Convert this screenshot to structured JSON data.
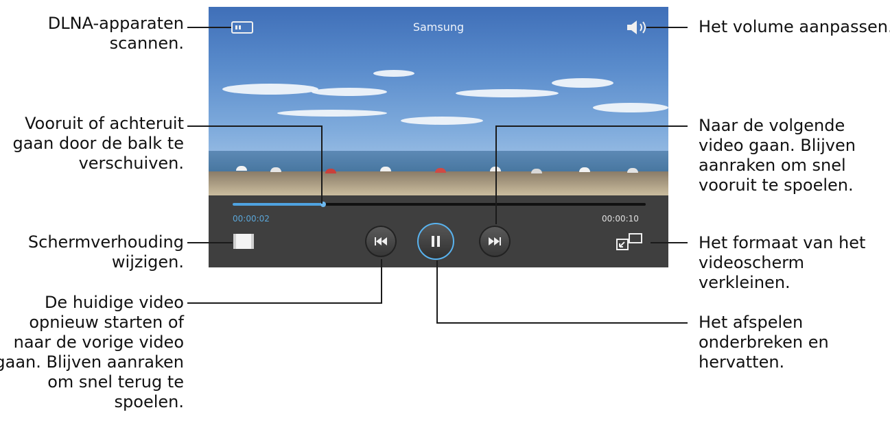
{
  "player": {
    "title": "Samsung",
    "time_current": "00:00:02",
    "time_total": "00:00:10",
    "progress": 0.22,
    "accent_color": "#4fa3e0",
    "icons": [
      "dlna-icon",
      "volume-icon",
      "aspect-ratio-icon",
      "rewind-icon",
      "pause-icon",
      "fast-forward-icon",
      "popup-player-icon"
    ]
  },
  "callouts": {
    "dlna": [
      "DLNA-apparaten",
      "scannen."
    ],
    "seek": [
      "Vooruit of achteruit",
      "gaan door de balk te",
      "verschuiven."
    ],
    "aspect": [
      "Schermverhouding",
      "wijzigen."
    ],
    "previous": [
      "De huidige video",
      "opnieuw starten of",
      "naar de vorige video",
      "gaan. Blijven aanraken",
      "om snel terug te",
      "spoelen."
    ],
    "volume": [
      "Het volume aanpassen."
    ],
    "next": [
      "Naar de volgende",
      "video gaan. Blijven",
      "aanraken om snel",
      "vooruit te spoelen."
    ],
    "resize": [
      "Het formaat van het",
      "videoscherm",
      "verkleinen."
    ],
    "pause": [
      "Het afspelen",
      "onderbreken en",
      "hervatten."
    ]
  }
}
